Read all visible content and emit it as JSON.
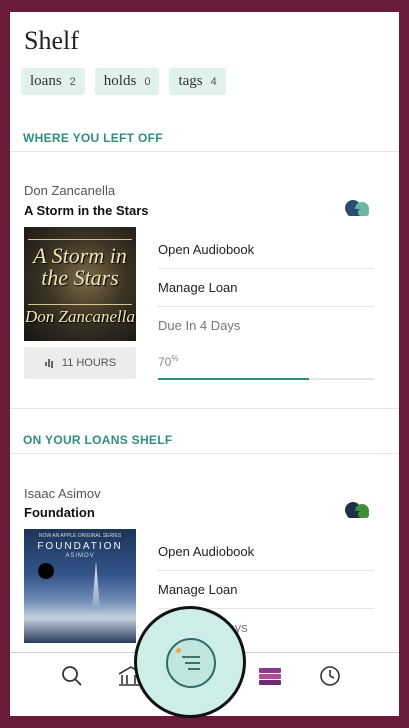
{
  "header": {
    "title": "Shelf"
  },
  "chips": [
    {
      "label": "loans",
      "count": "2"
    },
    {
      "label": "holds",
      "count": "0"
    },
    {
      "label": "tags",
      "count": "4"
    }
  ],
  "sections": {
    "left_off": "WHERE YOU LEFT OFF",
    "loans_shelf": "ON YOUR LOANS SHELF"
  },
  "books": [
    {
      "author": "Don Zancanella",
      "title": "A Storm in the Stars",
      "cover_text": {
        "line1": "A Storm in the Stars",
        "line2": "Don Zancanella"
      },
      "actions": {
        "open": "Open Audiobook",
        "manage": "Manage Loan",
        "due": "Due In 4 Days"
      },
      "duration": "11 HOURS",
      "progress_label": "70",
      "progress_unit": "%",
      "progress": 0.7
    },
    {
      "author": "Isaac Asimov",
      "title": "Foundation",
      "cover_text": {
        "top": "NOW AN APPLE ORIGINAL SERIES",
        "title": "FOUNDATION",
        "author": "ASIMOV"
      },
      "actions": {
        "open": "Open Audiobook",
        "manage": "Manage Loan",
        "due": "Due In 10 Days"
      }
    }
  ],
  "nav": {
    "items": [
      "search-icon",
      "library-icon",
      "menu-icon",
      "shelf-icon",
      "history-icon"
    ]
  },
  "colors": {
    "accent": "#2e8f7f",
    "frame": "#6b1b3a",
    "chip_bg": "#e1f1ee",
    "cloud_dark": "#2a4d6e",
    "cloud_light": "#6ab6a3"
  }
}
